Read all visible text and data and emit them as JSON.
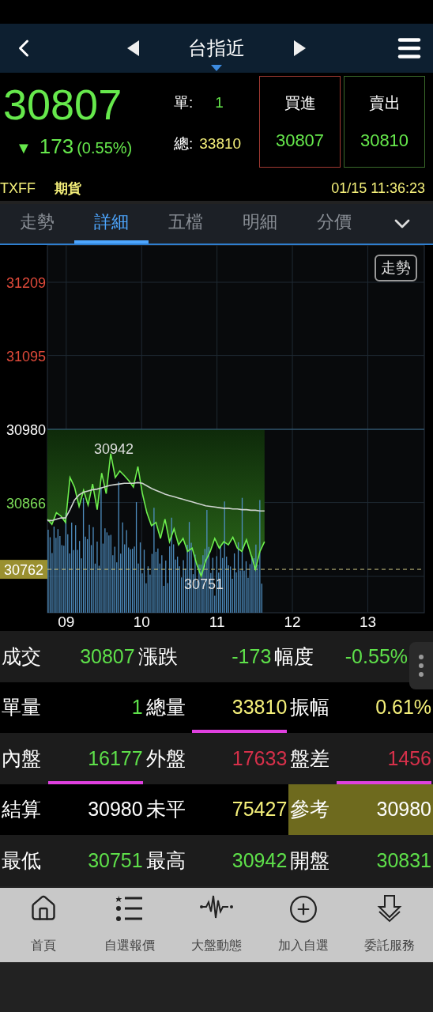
{
  "header": {
    "title": "台指近"
  },
  "quote": {
    "price": "30807",
    "change_arrow": "▼",
    "change": "173",
    "change_pct": "(0.55%)",
    "single_label": "單:",
    "single_value": "1",
    "total_label": "總:",
    "total_value": "33810",
    "buy": {
      "label": "買進",
      "value": "30807"
    },
    "sell": {
      "label": "賣出",
      "value": "30810"
    }
  },
  "info": {
    "code": "TXFF",
    "type": "期貨",
    "time": "01/15 11:36:23"
  },
  "tabs": [
    {
      "label": "走勢",
      "selected": false
    },
    {
      "label": "詳細",
      "selected": true
    },
    {
      "label": "五檔",
      "selected": false
    },
    {
      "label": "明細",
      "selected": false
    },
    {
      "label": "分價",
      "selected": false
    }
  ],
  "chart": {
    "button": "走勢",
    "y_labels": [
      {
        "text": "31209",
        "color": "#e04a3a"
      },
      {
        "text": "31095",
        "color": "#e04a3a"
      },
      {
        "text": "30980",
        "color": "#ffffff"
      },
      {
        "text": "30866",
        "color": "#7ee05a"
      }
    ],
    "chart_data": {
      "type": "line",
      "grid": true,
      "xlim": [
        8.75,
        13.75
      ],
      "ylim": [
        30694.4,
        31266.9
      ],
      "ref_lines": [
        {
          "axis": "y",
          "value": 30980,
          "color": "#3a6a8a"
        },
        {
          "axis": "y",
          "value": 30762,
          "color": "#c8c080",
          "label": "30762"
        }
      ],
      "yticks": [
        31209,
        31095,
        30980,
        30866
      ],
      "xticks": [
        {
          "value": 9,
          "label": "09"
        },
        {
          "value": 10,
          "label": "10"
        },
        {
          "value": 11,
          "label": "11"
        },
        {
          "value": 12,
          "label": "12"
        },
        {
          "value": 13,
          "label": "13"
        }
      ],
      "x": [
        8.75,
        8.81,
        8.87,
        8.93,
        8.99,
        9.05,
        9.11,
        9.17,
        9.23,
        9.29,
        9.35,
        9.41,
        9.47,
        9.53,
        9.59,
        9.65,
        9.71,
        9.77,
        9.83,
        9.89,
        9.95,
        10.01,
        10.07,
        10.13,
        10.19,
        10.25,
        10.31,
        10.37,
        10.43,
        10.49,
        10.55,
        10.61,
        10.67,
        10.73,
        10.79,
        10.85,
        10.91,
        10.97,
        11.03,
        11.09,
        11.15,
        11.21,
        11.27,
        11.33,
        11.39,
        11.45,
        11.51,
        11.57,
        11.63
      ],
      "series": [
        {
          "color": "#6ef04e",
          "values": [
            30840,
            30832,
            30850,
            30845,
            30835,
            30905,
            30890,
            30860,
            30885,
            30862,
            30895,
            30855,
            30912,
            30880,
            30942,
            30905,
            30915,
            30908,
            30900,
            30890,
            30922,
            30880,
            30850,
            30830,
            30835,
            30810,
            30840,
            30805,
            30825,
            30800,
            30810,
            30790,
            30795,
            30770,
            30751,
            30775,
            30790,
            30810,
            30795,
            30805,
            30800,
            30812,
            30795,
            30790,
            30808,
            30785,
            30762,
            30790,
            30805
          ]
        },
        {
          "color": "#cfd4d0",
          "values": [
            30838,
            30838,
            30840,
            30842,
            30842,
            30855,
            30870,
            30878,
            30882,
            30884,
            30886,
            30887,
            30889,
            30891,
            30893,
            30894,
            30895,
            30896,
            30896,
            30896,
            30897,
            30896,
            30892,
            30888,
            30885,
            30882,
            30879,
            30877,
            30875,
            30873,
            30871,
            30869,
            30867,
            30865,
            30863,
            30861,
            30860,
            30859,
            30858,
            30857,
            30857,
            30856,
            30856,
            30855,
            30855,
            30854,
            30854,
            30853,
            30853
          ]
        }
      ]
    },
    "high_label": "30942",
    "low_label": "30751"
  },
  "table": [
    [
      {
        "label": "成交",
        "value": "30807",
        "color": "#5ee04a",
        "underlined": false,
        "highlighted": false
      },
      {
        "label": "漲跌",
        "value": "-173",
        "color": "#5ee04a",
        "underlined": false,
        "highlighted": false
      },
      {
        "label": "幅度",
        "value": "-0.55%",
        "color": "#5ee04a",
        "underlined": false,
        "highlighted": false
      }
    ],
    [
      {
        "label": "單量",
        "value": "1",
        "color": "#5ee04a",
        "underlined": false,
        "highlighted": false
      },
      {
        "label": "總量",
        "value": "33810",
        "color": "#f5f07a",
        "underlined": true,
        "highlighted": false
      },
      {
        "label": "振幅",
        "value": "0.61%",
        "color": "#f5f07a",
        "underlined": false,
        "highlighted": false
      }
    ],
    [
      {
        "label": "內盤",
        "value": "16177",
        "color": "#5ee04a",
        "underlined": true,
        "highlighted": false
      },
      {
        "label": "外盤",
        "value": "17633",
        "color": "#d6304a",
        "underlined": false,
        "highlighted": false
      },
      {
        "label": "盤差",
        "value": "1456",
        "color": "#d6304a",
        "underlined": true,
        "highlighted": false
      }
    ],
    [
      {
        "label": "結算",
        "value": "30980",
        "color": "#ffffff",
        "underlined": false,
        "highlighted": false
      },
      {
        "label": "未平",
        "value": "75427",
        "color": "#f5f07a",
        "underlined": false,
        "highlighted": false
      },
      {
        "label": "參考",
        "value": "30980",
        "color": "#ffffff",
        "underlined": false,
        "highlighted": true
      }
    ],
    [
      {
        "label": "最低",
        "value": "30751",
        "color": "#5ee04a",
        "underlined": false,
        "highlighted": false
      },
      {
        "label": "最高",
        "value": "30942",
        "color": "#5ee04a",
        "underlined": false,
        "highlighted": false
      },
      {
        "label": "開盤",
        "value": "30831",
        "color": "#5ee04a",
        "underlined": false,
        "highlighted": false
      }
    ]
  ],
  "nav": [
    {
      "kind": "home",
      "label": "首頁"
    },
    {
      "kind": "watchlist",
      "label": "自選報價"
    },
    {
      "kind": "pulse",
      "label": "大盤動態"
    },
    {
      "kind": "add",
      "label": "加入自選"
    },
    {
      "kind": "order",
      "label": "委託服務"
    }
  ]
}
